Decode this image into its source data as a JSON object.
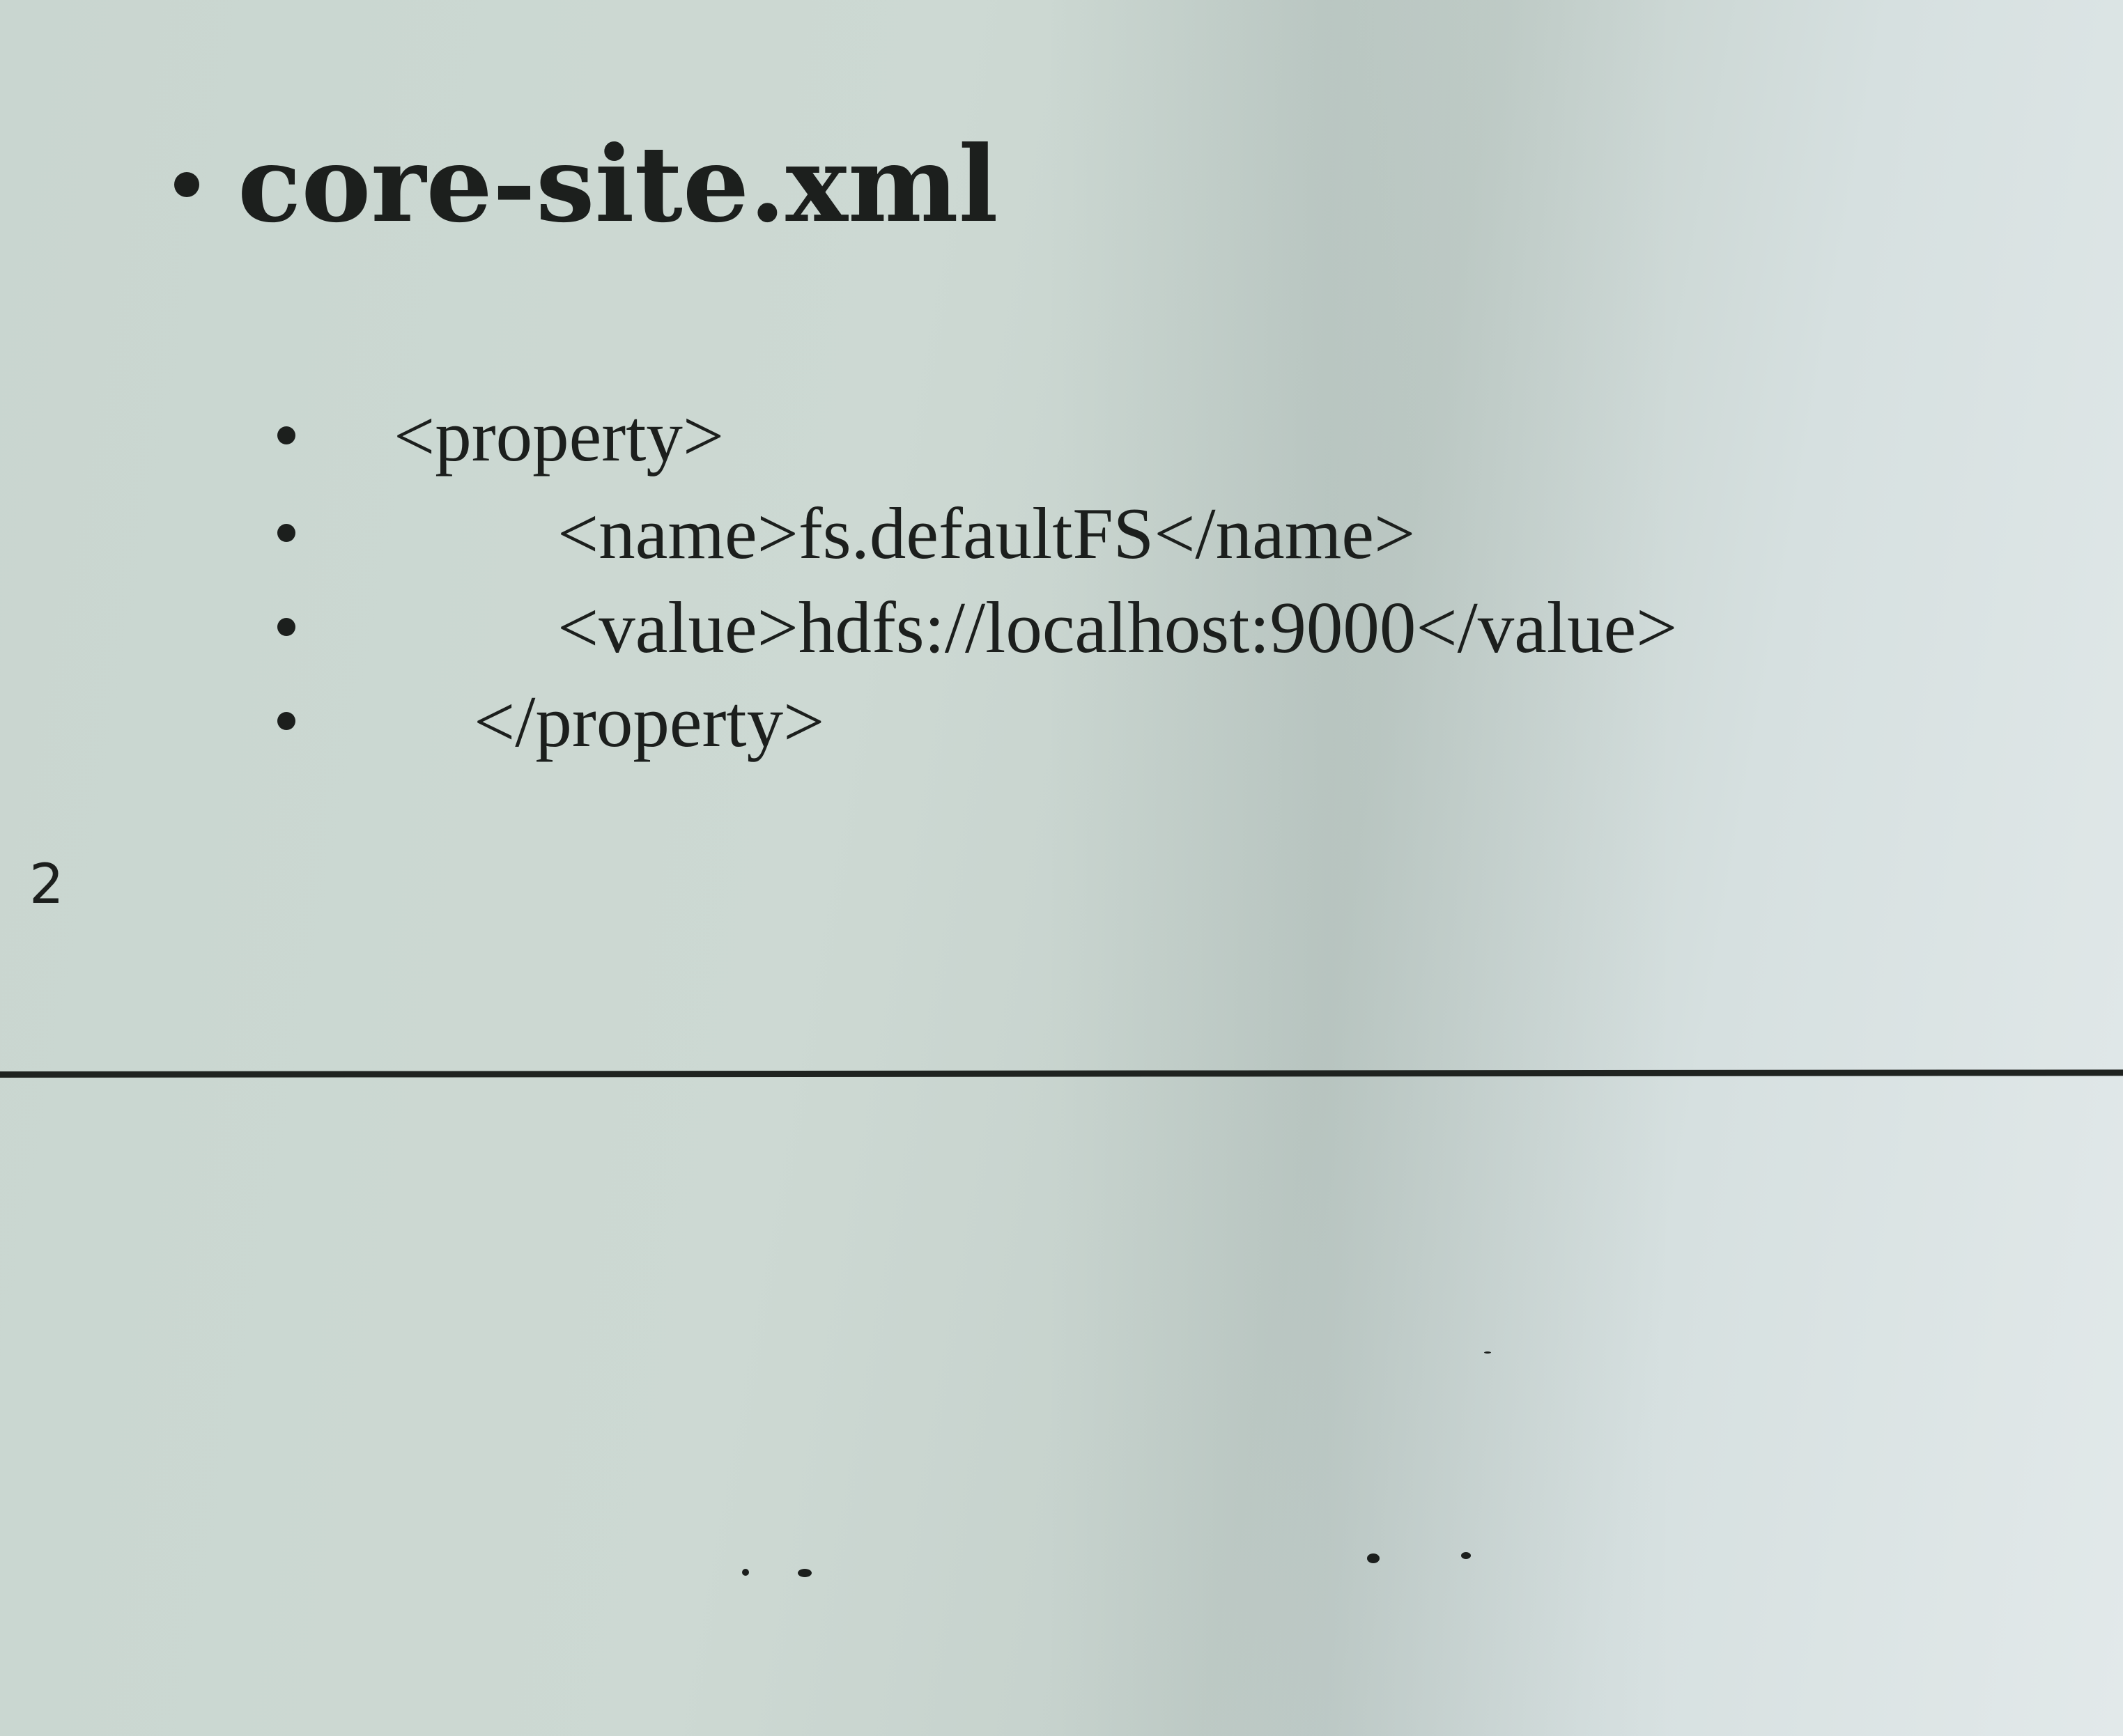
{
  "heading": "core-site.xml",
  "code_lines": [
    "<property>",
    "<name>fs.defaultFS</name>",
    "<value>hdfs://localhost:9000</value>",
    "</property>"
  ],
  "page_number": "2"
}
